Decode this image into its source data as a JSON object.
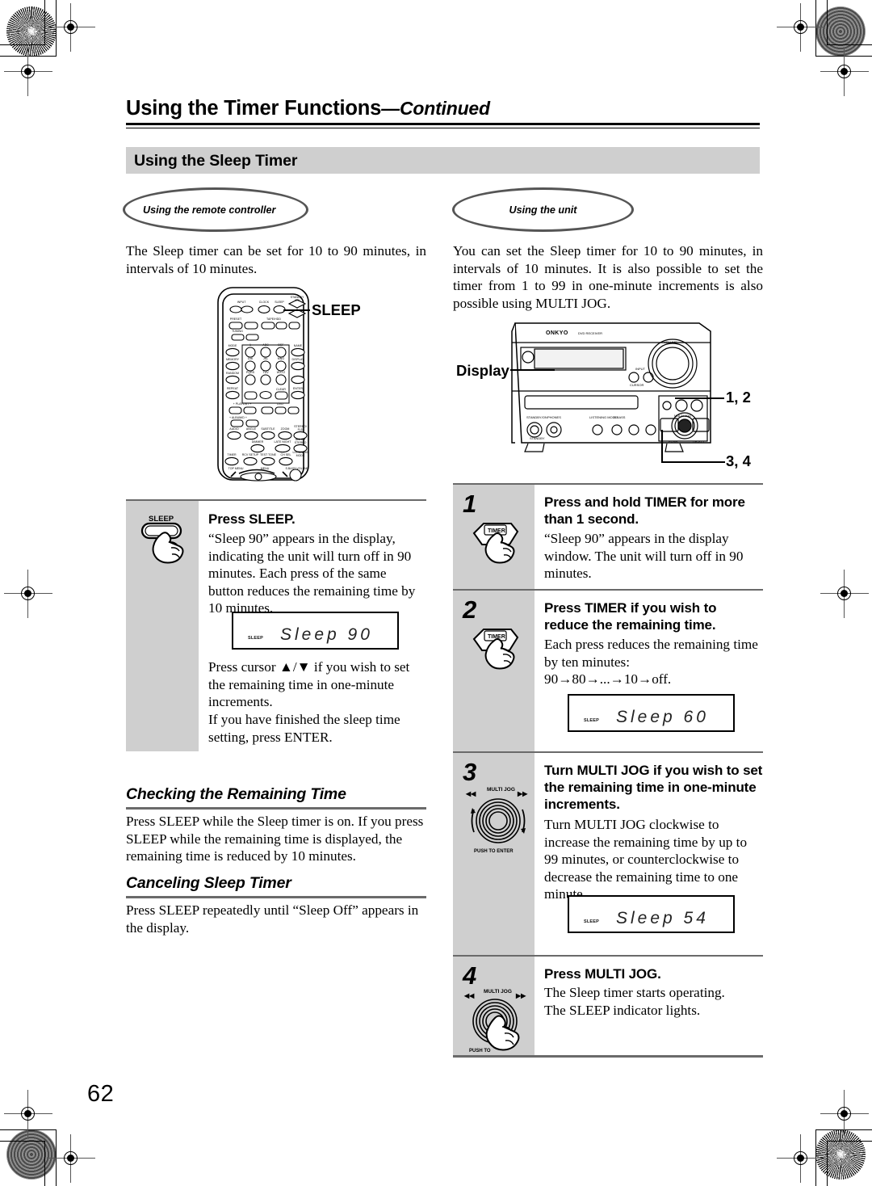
{
  "page": {
    "number": "62",
    "chapter_title": "Using the Timer Functions",
    "chapter_continued": "—Continued",
    "section_title": "Using the Sleep Timer"
  },
  "left_column": {
    "ellipse_label": "Using the remote controller",
    "intro": "The Sleep timer can be set for 10 to 90 minutes, in intervals of 10 minutes.",
    "remote_callout": "SLEEP",
    "step": {
      "button_label": "SLEEP",
      "heading": "Press SLEEP.",
      "body_1": "“Sleep 90” appears in the display, indicating the unit will turn off in 90 minutes. Each press of the same button reduces the remaining time by 10 minutes.",
      "lcd_indicator": "SLEEP",
      "lcd_text": "Sleep 90",
      "body_2": "Press cursor ▲/▼ if you wish to set the remaining time in one-minute increments.",
      "body_3": "If you have finished the sleep time setting, press ENTER."
    },
    "checking": {
      "heading": "Checking the Remaining Time",
      "body": "Press SLEEP while the Sleep timer is on. If you press SLEEP while the remaining time is displayed, the remaining time is reduced by 10 minutes."
    },
    "canceling": {
      "heading": "Canceling Sleep Timer",
      "body": "Press SLEEP repeatedly until “Sleep Off” appears in the display."
    }
  },
  "right_column": {
    "ellipse_label": "Using the unit",
    "intro": "You can set the Sleep timer for 10 to 90 minutes, in intervals of 10 minutes. It is also possible to set the timer from 1 to 99 in one-minute increments is also possible using MULTI JOG.",
    "unit_callouts": {
      "display": "Display",
      "steps_12": "1, 2",
      "steps_34": "3, 4",
      "brand": "ONKYO",
      "model": "DVD RECEIVER",
      "volume": "VOLUME",
      "multi_jog": "MULTI JOG",
      "standby_on": "STANDBY/ON",
      "phones": "PHONES",
      "model_no": "DR-815"
    },
    "steps": [
      {
        "number": "1",
        "button_label": "TIMER",
        "heading": "Press and hold TIMER for more than 1 second.",
        "body": "“Sleep 90” appears in the display window. The unit will turn off in 90 minutes.",
        "lcd": null
      },
      {
        "number": "2",
        "button_label": "TIMER",
        "heading": "Press TIMER if you wish to reduce the remaining time.",
        "body": "Each press reduces the remaining time by ten minutes:",
        "body_extra": "90→80→...→10→off.",
        "lcd": {
          "indicator": "SLEEP",
          "text": "Sleep 60"
        }
      },
      {
        "number": "3",
        "button_label": "MULTI JOG",
        "button_sub": "PUSH TO ENTER",
        "heading": "Turn MULTI JOG if you wish to set the remaining time in one-minute increments.",
        "body": "Turn MULTI JOG clockwise to increase the remaining time by up to 99 minutes, or counterclockwise to decrease the remaining time to one minute.",
        "lcd": {
          "indicator": "SLEEP",
          "text": "Sleep 54"
        }
      },
      {
        "number": "4",
        "button_label": "MULTI JOG",
        "button_sub": "PUSH TO",
        "heading": "Press MULTI JOG.",
        "body": "The Sleep timer starts operating.",
        "body_2": "The SLEEP indicator lights.",
        "lcd": null
      }
    ]
  },
  "colors": {
    "gray_bar": "#cfcfcf",
    "rule": "#6a6a6a",
    "ellipse_stroke": "#555555"
  }
}
